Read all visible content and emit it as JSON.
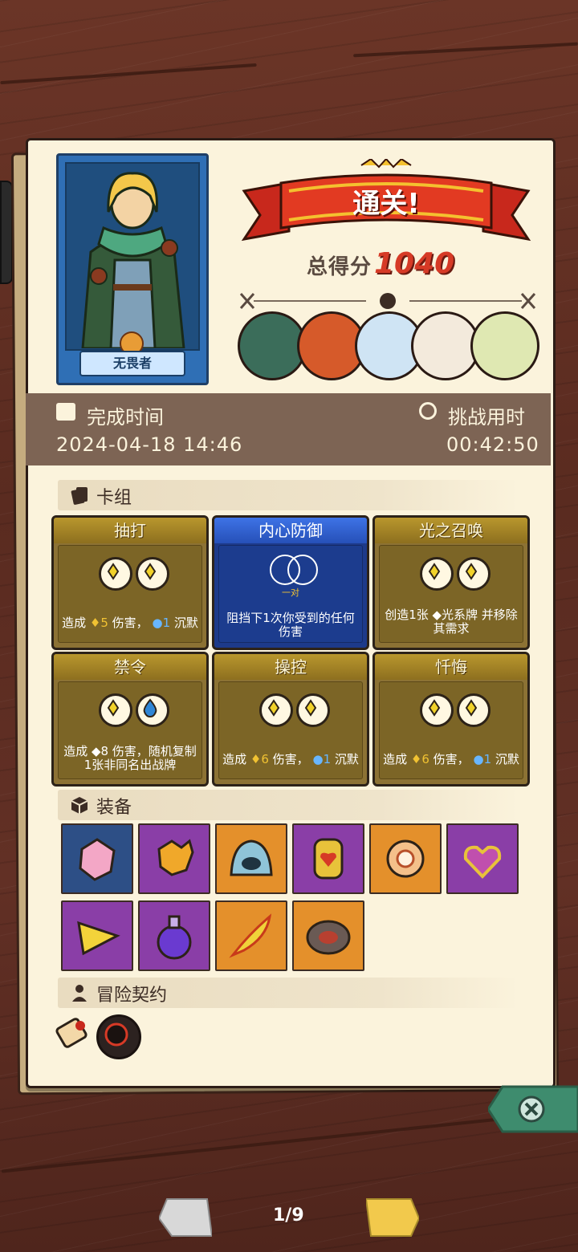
{
  "hero": {
    "name": "无畏者"
  },
  "result": {
    "banner": "通关!",
    "score_label": "总得分",
    "score": "1040"
  },
  "time": {
    "finish_label": "完成时间",
    "finish_value": "2024-04-18 14:46",
    "duration_label": "挑战用时",
    "duration_value": "00:42:50"
  },
  "deck": {
    "title": "卡组",
    "cards": [
      {
        "name": "抽打",
        "color": "gold",
        "slots": [
          "energy",
          "energy"
        ],
        "desc_pre": "造成",
        "n1": "5",
        "mid": "伤害，",
        "n2": "1",
        "post": "沉默"
      },
      {
        "name": "内心防御",
        "color": "blue",
        "slots": [
          "pair"
        ],
        "pair_label": "一对",
        "desc": "阻挡下1次你受到的任何伤害"
      },
      {
        "name": "光之召唤",
        "color": "gold",
        "slots": [
          "energy",
          "energy"
        ],
        "desc": "创造1张 ◆光系牌 并移除其需求"
      },
      {
        "name": "禁令",
        "color": "gold",
        "slots": [
          "energy",
          "water"
        ],
        "desc": "造成 ◆8 伤害，随机复制1张非同名出战牌"
      },
      {
        "name": "操控",
        "color": "gold",
        "slots": [
          "energy",
          "energy"
        ],
        "desc_pre": "造成",
        "n1": "6",
        "mid": "伤害，",
        "n2": "1",
        "post": "沉默"
      },
      {
        "name": "忏悔",
        "color": "gold",
        "slots": [
          "energy",
          "energy"
        ],
        "desc_pre": "造成",
        "n1": "6",
        "mid": "伤害，",
        "n2": "1",
        "post": "沉默"
      }
    ]
  },
  "equipment": {
    "title": "装备",
    "items": [
      {
        "icon": "pink-crystal-icon",
        "bg": "navy"
      },
      {
        "icon": "golden-hand-icon",
        "bg": "purple"
      },
      {
        "icon": "blue-slime-icon",
        "bg": "orange"
      },
      {
        "icon": "heart-gem-icon",
        "bg": "purple"
      },
      {
        "icon": "orange-ring-icon",
        "bg": "orange"
      },
      {
        "icon": "heart-amulet-icon",
        "bg": "purple"
      },
      {
        "icon": "gold-triangle-icon",
        "bg": "purple"
      },
      {
        "icon": "purple-potion-icon",
        "bg": "purple"
      },
      {
        "icon": "fire-feather-icon",
        "bg": "orange"
      },
      {
        "icon": "dark-disc-icon",
        "bg": "orange"
      }
    ]
  },
  "contract": {
    "title": "冒险契约",
    "items": [
      "scroll-icon",
      "red-rune-icon"
    ]
  },
  "pager": {
    "text": "1/9"
  },
  "colors": {
    "accent_red": "#d63a26",
    "paper": "#fbf3dc",
    "timebar": "#7d6454",
    "close_green": "#3e8c6e"
  }
}
